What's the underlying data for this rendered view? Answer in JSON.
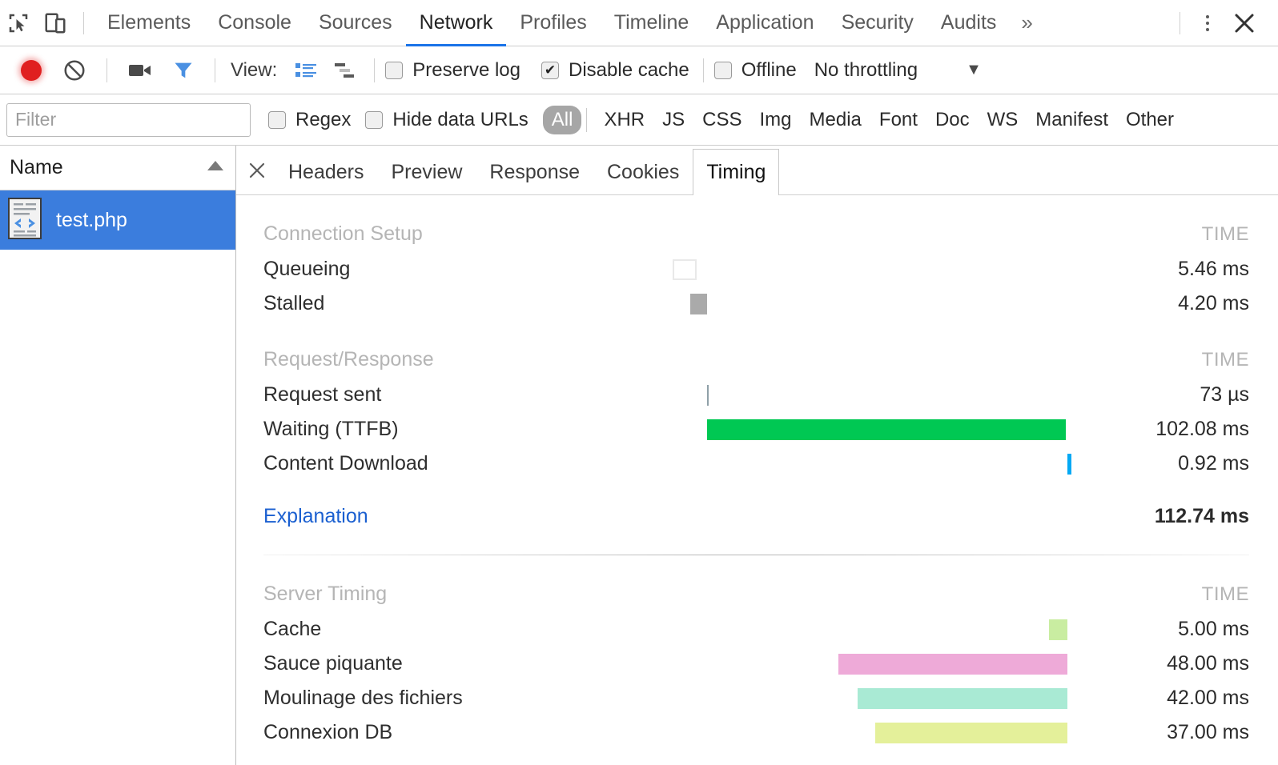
{
  "window": {
    "main_tabs": [
      {
        "label": "Elements",
        "active": false
      },
      {
        "label": "Console",
        "active": false
      },
      {
        "label": "Sources",
        "active": false
      },
      {
        "label": "Network",
        "active": true
      },
      {
        "label": "Profiles",
        "active": false
      },
      {
        "label": "Timeline",
        "active": false
      },
      {
        "label": "Application",
        "active": false
      },
      {
        "label": "Security",
        "active": false
      },
      {
        "label": "Audits",
        "active": false
      }
    ],
    "more_tabs_label": "»",
    "menu_icon": "kebab-menu-icon",
    "close_icon": "close-icon",
    "inspect_icon": "inspect-element-icon",
    "device_icon": "device-toolbar-icon"
  },
  "toolbar": {
    "record_icon": "record-icon",
    "clear_icon": "clear-icon",
    "capture_screenshots_icon": "camera-icon",
    "filter_icon": "filter-icon",
    "view_label": "View:",
    "view_list_icon": "list-view-icon",
    "view_waterfall_icon": "waterfall-view-icon",
    "preserve_log": {
      "label": "Preserve log",
      "checked": false
    },
    "disable_cache": {
      "label": "Disable cache",
      "checked": true
    },
    "offline": {
      "label": "Offline",
      "checked": false
    },
    "throttling": {
      "value": "No throttling",
      "caret": "▼"
    }
  },
  "filterbar": {
    "filter_placeholder": "Filter",
    "filter_value": "",
    "regex": {
      "label": "Regex",
      "checked": false
    },
    "hide_data_urls": {
      "label": "Hide data URLs",
      "checked": false
    },
    "types": [
      {
        "label": "All",
        "selected": true
      },
      {
        "label": "XHR",
        "selected": false
      },
      {
        "label": "JS",
        "selected": false
      },
      {
        "label": "CSS",
        "selected": false
      },
      {
        "label": "Img",
        "selected": false
      },
      {
        "label": "Media",
        "selected": false
      },
      {
        "label": "Font",
        "selected": false
      },
      {
        "label": "Doc",
        "selected": false
      },
      {
        "label": "WS",
        "selected": false
      },
      {
        "label": "Manifest",
        "selected": false
      },
      {
        "label": "Other",
        "selected": false
      }
    ]
  },
  "requests": {
    "column_name": "Name",
    "sort_icon": "sort-ascending-icon",
    "rows": [
      {
        "name": "test.php",
        "icon": "document-code-icon",
        "selected": true
      }
    ]
  },
  "detail": {
    "close_icon": "close-icon",
    "tabs": [
      {
        "label": "Headers",
        "active": false
      },
      {
        "label": "Preview",
        "active": false
      },
      {
        "label": "Response",
        "active": false
      },
      {
        "label": "Cookies",
        "active": false
      },
      {
        "label": "Timing",
        "active": true
      }
    ]
  },
  "colors": {
    "queueing": "#ffffff",
    "queueing_border": "#e6e6e6",
    "stalled": "#aaaaaa",
    "request_sent": "#8fa0a8",
    "waiting": "#00c853",
    "content_download": "#03a9f4",
    "cache": "#c9eda1",
    "sauce_piquante": "#eeaad8",
    "moulinage": "#a9ead4",
    "connexion_db": "#e4f09a",
    "link": "#1a5fd0",
    "selected_row": "#3b7ddd"
  },
  "chart_data": {
    "type": "bar",
    "title": "Timing",
    "xlabel": "",
    "ylabel": "",
    "time_column_header": "TIME",
    "sections": [
      {
        "name": "Connection Setup",
        "time_header": "TIME",
        "rows": [
          {
            "label": "Queueing",
            "time": "5.46 ms",
            "value_ms": 5.46,
            "bar": {
              "left_pct": 26.8,
              "width_pct": 4.3,
              "color": "#ffffff",
              "border": "#e6e6e6"
            }
          },
          {
            "label": "Stalled",
            "time": "4.20 ms",
            "value_ms": 4.2,
            "bar": {
              "left_pct": 30.0,
              "width_pct": 2.9,
              "color": "#aaaaaa",
              "border": ""
            }
          }
        ]
      },
      {
        "name": "Request/Response",
        "time_header": "TIME",
        "rows": [
          {
            "label": "Request sent",
            "time": "73 µs",
            "value_ms": 0.073,
            "bar": {
              "left_pct": 32.9,
              "width_pct": 0.25,
              "color": "#8fa0a8",
              "border": ""
            }
          },
          {
            "label": "Waiting (TTFB)",
            "time": "102.08 ms",
            "value_ms": 102.08,
            "bar": {
              "left_pct": 32.9,
              "width_pct": 63.0,
              "color": "#00c853",
              "border": ""
            }
          },
          {
            "label": "Content Download",
            "time": "0.92 ms",
            "value_ms": 0.92,
            "bar": {
              "left_pct": 96.2,
              "width_pct": 0.5,
              "color": "#03a9f4",
              "border": ""
            }
          }
        ]
      }
    ],
    "total": {
      "label": "Explanation",
      "time": "112.74 ms",
      "value_ms": 112.74,
      "is_link": true
    },
    "server_timing": {
      "name": "Server Timing",
      "time_header": "TIME",
      "rows": [
        {
          "label": "Cache",
          "time": "5.00 ms",
          "value_ms": 5.0,
          "bar": {
            "left_pct": 93.0,
            "width_pct": 3.2,
            "color": "#c9eda1",
            "border": ""
          }
        },
        {
          "label": "Sauce piquante",
          "time": "48.00 ms",
          "value_ms": 48.0,
          "bar": {
            "left_pct": 56.0,
            "width_pct": 40.2,
            "color": "#eeaad8",
            "border": ""
          }
        },
        {
          "label": "Moulinage des fichiers",
          "time": "42.00 ms",
          "value_ms": 42.0,
          "bar": {
            "left_pct": 59.4,
            "width_pct": 36.8,
            "color": "#a9ead4",
            "border": ""
          }
        },
        {
          "label": "Connexion DB",
          "time": "37.00 ms",
          "value_ms": 37.0,
          "bar": {
            "left_pct": 62.4,
            "width_pct": 33.8,
            "color": "#e4f09a",
            "border": ""
          }
        }
      ]
    }
  }
}
